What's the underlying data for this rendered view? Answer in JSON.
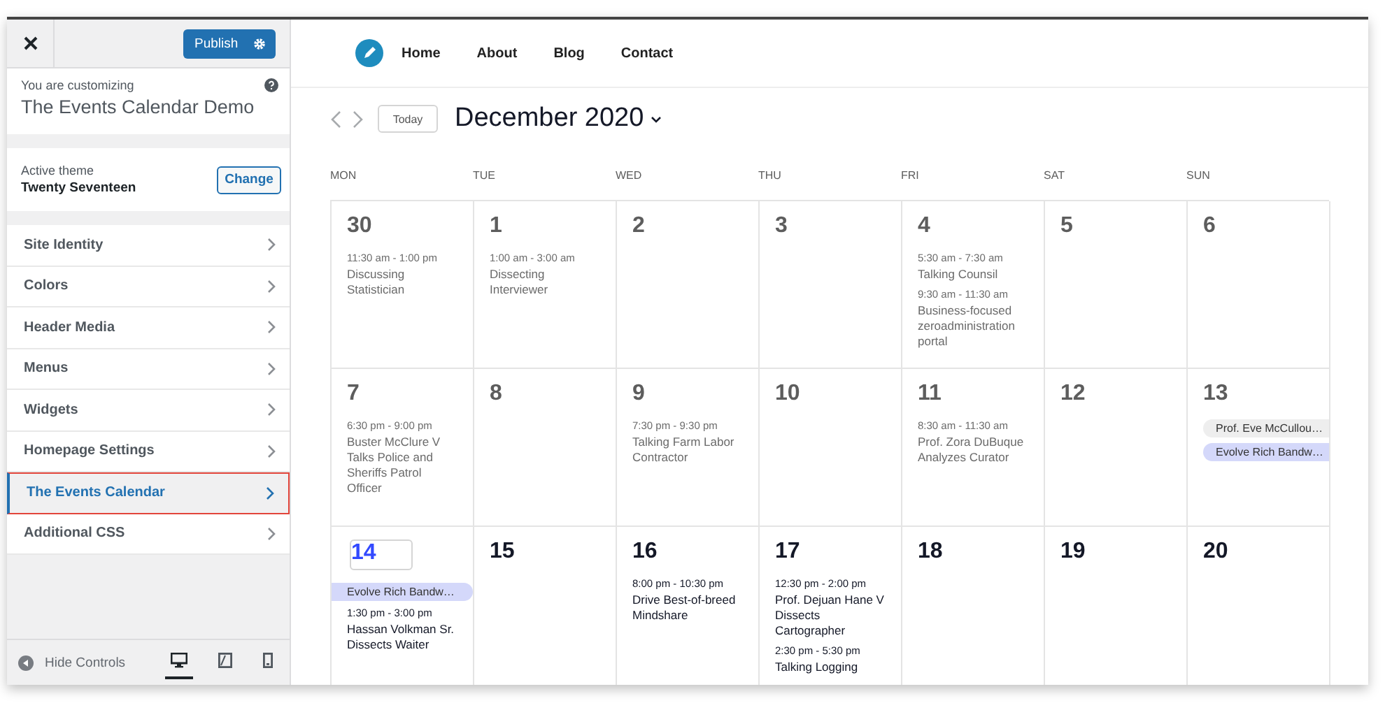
{
  "sidebar": {
    "publish_button": "Publish",
    "customizing_label": "You are customizing",
    "site_title": "The Events Calendar Demo",
    "theme_label": "Active theme",
    "theme_name": "Twenty Seventeen",
    "change_button": "Change",
    "sections": [
      {
        "label": "Site Identity",
        "selected": false
      },
      {
        "label": "Colors",
        "selected": false
      },
      {
        "label": "Header Media",
        "selected": false
      },
      {
        "label": "Menus",
        "selected": false
      },
      {
        "label": "Widgets",
        "selected": false
      },
      {
        "label": "Homepage Settings",
        "selected": false
      },
      {
        "label": "The Events Calendar",
        "selected": true
      },
      {
        "label": "Additional CSS",
        "selected": false
      }
    ],
    "hide_controls": "Hide Controls",
    "devices": [
      {
        "kind": "desktop",
        "selected": true
      },
      {
        "kind": "tablet",
        "selected": false
      },
      {
        "kind": "mobile",
        "selected": false
      }
    ]
  },
  "preview": {
    "nav": [
      "Home",
      "About",
      "Blog",
      "Contact"
    ],
    "today_button": "Today",
    "month": "December 2020",
    "weekdays": [
      "MON",
      "TUE",
      "WED",
      "THU",
      "FRI",
      "SAT",
      "SUN"
    ],
    "weeks": [
      [
        {
          "day": "30",
          "past": true,
          "today": false,
          "events": [
            {
              "kind": "timed",
              "time": "11:30 am - 1:00 pm",
              "title": "Discussing Statistician"
            }
          ]
        },
        {
          "day": "1",
          "past": true,
          "today": false,
          "events": [
            {
              "kind": "timed",
              "time": "1:00 am - 3:00 am",
              "title": "Dissecting Interviewer"
            }
          ]
        },
        {
          "day": "2",
          "past": true,
          "today": false
        },
        {
          "day": "3",
          "past": true,
          "today": false
        },
        {
          "day": "4",
          "past": true,
          "today": false,
          "events": [
            {
              "kind": "timed",
              "time": "5:30 am - 7:30 am",
              "title": "Talking Counsil"
            },
            {
              "kind": "timed",
              "time": "9:30 am - 11:30 am",
              "title": "Business-focused zeroadministration portal"
            }
          ]
        },
        {
          "day": "5",
          "past": true,
          "today": false
        },
        {
          "day": "6",
          "past": true,
          "today": false
        }
      ],
      [
        {
          "day": "7",
          "past": true,
          "today": false,
          "events": [
            {
              "kind": "timed",
              "time": "6:30 pm - 9:00 pm",
              "title": "Buster McClure V Talks Police and Sheriffs Patrol Officer"
            }
          ]
        },
        {
          "day": "8",
          "past": true,
          "today": false
        },
        {
          "day": "9",
          "past": true,
          "today": false,
          "events": [
            {
              "kind": "timed",
              "time": "7:30 pm - 9:30 pm",
              "title": "Talking Farm Labor Contractor"
            }
          ]
        },
        {
          "day": "10",
          "past": true,
          "today": false
        },
        {
          "day": "11",
          "past": true,
          "today": false,
          "events": [
            {
              "kind": "timed",
              "time": "8:30 am - 11:30 am",
              "title": "Prof. Zora DuBuque Analyzes Curator"
            }
          ]
        },
        {
          "day": "12",
          "past": true,
          "today": false
        },
        {
          "day": "13",
          "past": true,
          "today": false,
          "events": [
            {
              "kind": "allday",
              "title": "Prof. Eve McCullou…",
              "color": "#eeeeee"
            },
            {
              "kind": "allday",
              "title": "Evolve Rich Bandw…",
              "color": "#d4d8fa"
            }
          ]
        }
      ],
      [
        {
          "day": "14",
          "past": false,
          "today": true,
          "events": [
            {
              "kind": "allday",
              "title": "Evolve Rich Bandw…",
              "color": "#d4d8fa"
            },
            {
              "kind": "timed",
              "time": "1:30 pm - 3:00 pm",
              "title": "Hassan Volkman Sr. Dissects Waiter"
            }
          ]
        },
        {
          "day": "15",
          "past": false,
          "today": false
        },
        {
          "day": "16",
          "past": false,
          "today": false,
          "events": [
            {
              "kind": "timed",
              "time": "8:00 pm - 10:30 pm",
              "title": "Drive Best-of-breed Mindshare"
            }
          ]
        },
        {
          "day": "17",
          "past": false,
          "today": false,
          "events": [
            {
              "kind": "timed",
              "time": "12:30 pm - 2:00 pm",
              "title": "Prof. Dejuan Hane V Dissects Cartographer"
            },
            {
              "kind": "timed",
              "time": "2:30 pm - 5:30 pm",
              "title": "Talking Logging"
            }
          ]
        },
        {
          "day": "18",
          "past": false,
          "today": false
        },
        {
          "day": "19",
          "past": false,
          "today": false
        },
        {
          "day": "20",
          "past": false,
          "today": false
        }
      ]
    ]
  }
}
